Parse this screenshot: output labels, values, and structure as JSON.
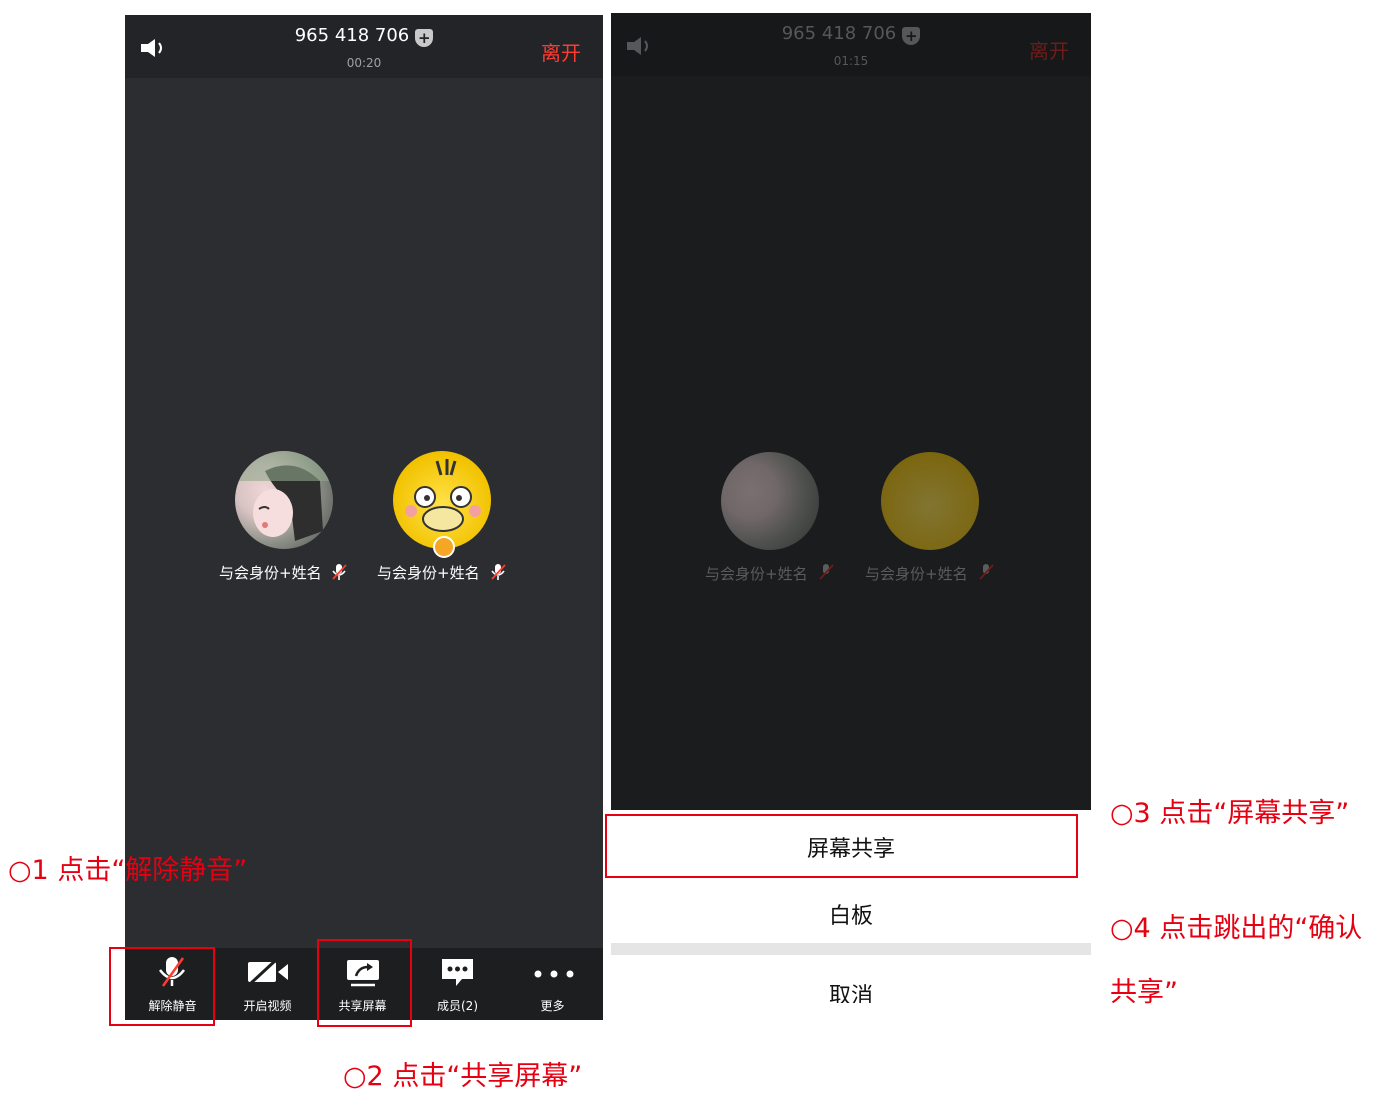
{
  "screen1": {
    "meeting_id": "965 418 706",
    "timer": "00:20",
    "leave_label": "离开",
    "participants": [
      {
        "name": "与会身份+姓名",
        "avatar": "anime-girl"
      },
      {
        "name": "与会身份+姓名",
        "avatar": "yellow-duck"
      }
    ],
    "toolbar": [
      {
        "label": "解除静音",
        "icon": "microphone-muted-icon"
      },
      {
        "label": "开启视频",
        "icon": "video-off-icon"
      },
      {
        "label": "共享屏幕",
        "icon": "share-screen-icon"
      },
      {
        "label": "成员(2)",
        "icon": "members-chat-icon"
      },
      {
        "label": "更多",
        "icon": "more-dots-icon"
      }
    ]
  },
  "screen2": {
    "meeting_id": "965 418 706",
    "timer": "01:15",
    "leave_label": "离开",
    "participants": [
      {
        "name": "与会身份+姓名"
      },
      {
        "name": "与会身份+姓名"
      }
    ],
    "sheet": {
      "option1": "屏幕共享",
      "option2": "白板",
      "cancel": "取消"
    }
  },
  "annotations": {
    "step1": "○1 点击“解除静音”",
    "step2": "○2 点击“共享屏幕”",
    "step3": "○3 点击“屏幕共享”",
    "step4": "○4 点击跳出的“确认共享”"
  },
  "colors": {
    "annotation_red": "#e60012",
    "leave_red": "#ff3b30",
    "meeting_bg": "#2b2d30",
    "toolbar_bg": "#1d1e20"
  }
}
